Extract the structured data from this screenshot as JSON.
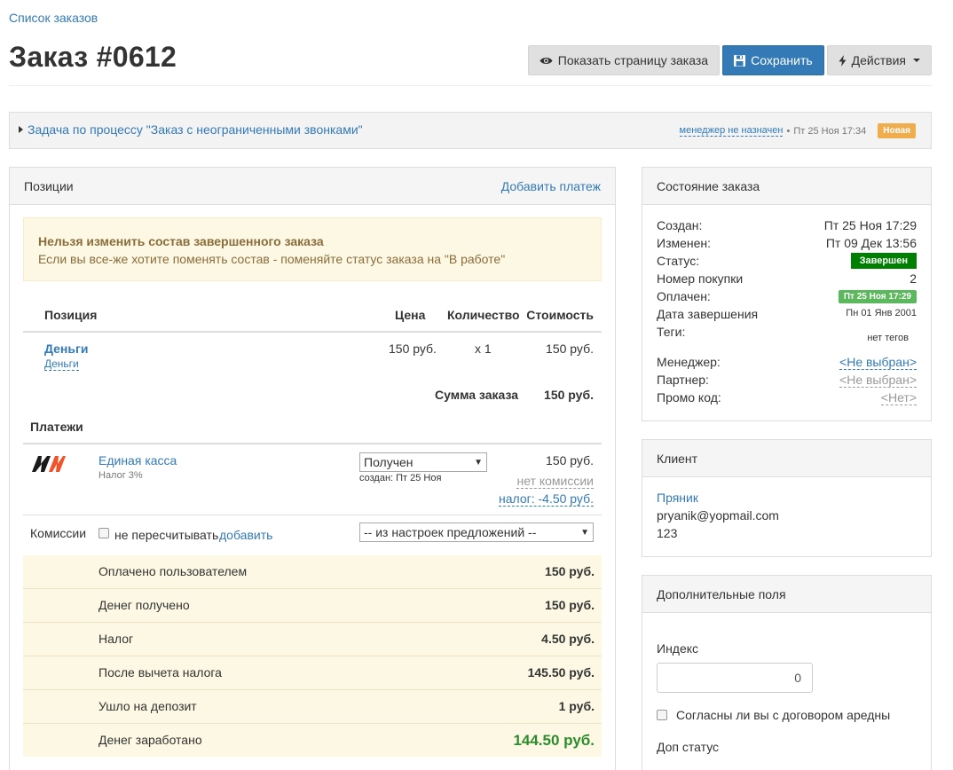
{
  "breadcrumb": "Список заказов",
  "title": "Заказ #0612",
  "buttons": {
    "show_order": "Показать страницу заказа",
    "save": "Сохранить",
    "actions": "Действия"
  },
  "task": {
    "link": "Задача по процессу \"Заказ с неограниченными звонками\"",
    "manager": "менеджер не назначен",
    "separator": "•",
    "date": "Пт 25 Ноя 17:34",
    "badge": "Новая"
  },
  "positions": {
    "heading": "Позиции",
    "add_payment": "Добавить платеж",
    "alert_title": "Нельзя изменить состав завершенного заказа",
    "alert_text": "Если вы все-же хотите поменять состав - поменяйте статус заказа на \"В работе\"",
    "columns": {
      "position": "Позиция",
      "price": "Цена",
      "qty": "Количество",
      "cost": "Стоимость"
    },
    "item": {
      "name": "Деньги",
      "sub": "Деньги",
      "price": "150 руб.",
      "qty": "x 1",
      "cost": "150 руб."
    },
    "total_label": "Сумма заказа",
    "total_value": "150 руб."
  },
  "payments": {
    "heading": "Платежи",
    "method": "Единая касса",
    "tax_note": "Налог 3%",
    "status_select": "Получен",
    "created": "создан: Пт 25 Ноя",
    "amount": "150 руб.",
    "no_commission": "нет комиссии",
    "tax_link": "налог: -4.50 руб.",
    "logo_colors": {
      "dark": "#1a1a1a",
      "accent": "#f0522a"
    }
  },
  "commissions": {
    "label": "Комиссии",
    "no_recalc": "не пересчитывать",
    "add": "добавить",
    "source_select": "-- из настроек предложений --"
  },
  "summary": [
    {
      "label": "Оплачено пользователем",
      "value": "150 руб."
    },
    {
      "label": "Денег получено",
      "value": "150 руб."
    },
    {
      "label": "Налог",
      "value": "4.50 руб."
    },
    {
      "label": "После вычета налога",
      "value": "145.50 руб."
    },
    {
      "label": "Ушло на депозит",
      "value": "1 руб."
    },
    {
      "label": "Денег заработано",
      "value": "144.50 руб."
    }
  ],
  "order_state": {
    "heading": "Состояние заказа",
    "created_label": "Создан:",
    "created_value": "Пт 25 Ноя 17:29",
    "modified_label": "Изменен:",
    "modified_value": "Пт 09 Дек 13:56",
    "status_label": "Статус:",
    "status_value": "Завершен",
    "purchase_no_label": "Номер покупки",
    "purchase_no_value": "2",
    "paid_label": "Оплачен:",
    "paid_value": "Пт 25 Ноя 17:29",
    "finish_label": "Дата завершения",
    "finish_value": "Пн 01 Янв 2001",
    "tags_label": "Теги:",
    "tags_value": "нет тегов",
    "manager_label": "Менеджер:",
    "manager_value": "<Не выбран>",
    "partner_label": "Партнер:",
    "partner_value": "<Не выбран>",
    "promo_label": "Промо код:",
    "promo_value": "<Нет>"
  },
  "client": {
    "heading": "Клиент",
    "name": "Пряник",
    "email": "pryanik@yopmail.com",
    "phone": "123"
  },
  "extra_fields": {
    "heading": "Дополнительные поля",
    "index_label": "Индекс",
    "index_value": "0",
    "agree_label": "Согласны ли вы с договором аредны",
    "extra_status_label": "Доп статус"
  }
}
